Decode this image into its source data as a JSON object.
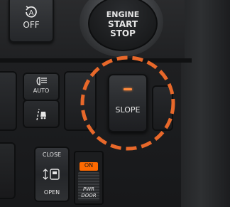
{
  "image_type": "photo-of-vehicle-dashboard-switch-panel",
  "engine_button": {
    "line1": "ENGINE",
    "line2": "START",
    "line3": "STOP"
  },
  "idle_stop_button": {
    "icon": "auto-idle-stop-icon",
    "label": "OFF"
  },
  "headlight_switch": {
    "icon": "headlight-leveling-icon",
    "label": "AUTO"
  },
  "lane_switch": {
    "icon": "lane-departure-icon"
  },
  "slope_button": {
    "label": "SLOPE",
    "indicator_color": "#ff8a3c"
  },
  "power_door_switch": {
    "close_label": "CLOSE",
    "open_label": "OPEN",
    "icon": "sliding-door-icon",
    "on_label": "ON",
    "pwr_label": "PWR",
    "door_label": "DOOR",
    "on_color": "#ff6a00"
  },
  "highlight": {
    "color": "#e8682a",
    "style": "dashed-circle"
  }
}
